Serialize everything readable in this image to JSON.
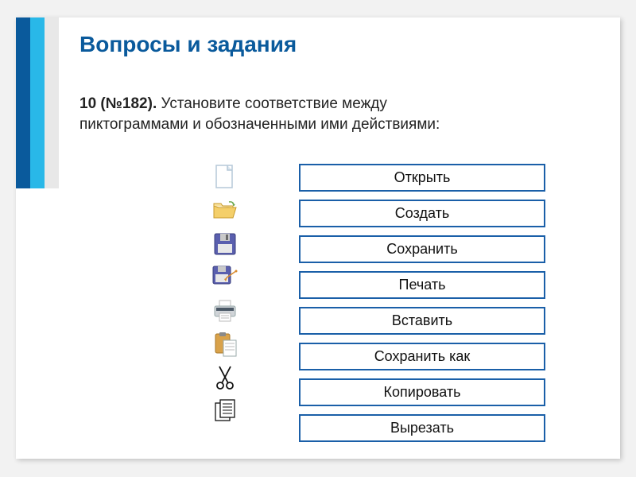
{
  "title": "Вопросы и задания",
  "task": {
    "number": "10 (№182).",
    "text": "Установите соответствие между пиктограммами и обозначенными ими действиями:"
  },
  "icons": [
    {
      "name": "new-document-icon"
    },
    {
      "name": "open-folder-icon"
    },
    {
      "name": "floppy-disk-icon"
    },
    {
      "name": "save-as-icon"
    },
    {
      "name": "printer-icon"
    },
    {
      "name": "clipboard-paste-icon"
    },
    {
      "name": "scissors-icon"
    },
    {
      "name": "copy-pages-icon"
    }
  ],
  "actions": [
    {
      "label": "Открыть"
    },
    {
      "label": "Создать"
    },
    {
      "label": "Сохранить"
    },
    {
      "label": "Печать"
    },
    {
      "label": "Вставить"
    },
    {
      "label": "Сохранить как"
    },
    {
      "label": "Копировать"
    },
    {
      "label": "Вырезать"
    }
  ]
}
